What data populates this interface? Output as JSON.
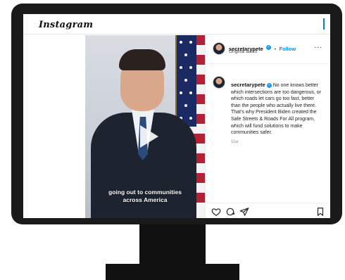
{
  "app": {
    "logo_text": "Instagram"
  },
  "media": {
    "caption_line1": "going out to communities",
    "caption_line2": "across America",
    "play_icon": "play-icon"
  },
  "post": {
    "username": "secretarypete",
    "follow_label": "Follow",
    "separator": "•",
    "audio_label": "Original audio",
    "more_label": "...",
    "comment_text": "No one knows better which intersections are too dangerous, or which roads let cars go too fast, better than the people who actually live there. That's why President Biden created the Safe Streets & Roads For All program, which will fund solutions to make communities safer.",
    "time": "11w"
  },
  "actions": {
    "like_icon": "heart-icon",
    "comment_icon": "comment-icon",
    "share_icon": "share-icon",
    "save_icon": "bookmark-icon"
  },
  "colors": {
    "accent": "#0095f6",
    "verified": "#1d9bf0",
    "bezel": "#1a1a1a"
  }
}
